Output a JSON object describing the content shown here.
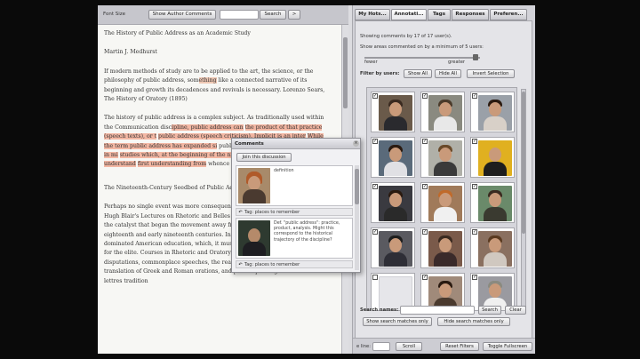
{
  "toolbar": {
    "font_size_label": "Font Size",
    "show_author_comments": "Show Author Comments",
    "search_button": "Search",
    "next_button": ">"
  },
  "document": {
    "title": "The History of Public Address as an Academic Study",
    "author": "Martin J. Medhurst",
    "p1": {
      "a": "If modern methods of study are to be applied to the art, the science, or the philosophy of public address, som",
      "hl": "ething",
      "b": " like a connected narrative of its beginning and growth its decadences and revivals is necessary.  Lorenzo Sears, The History of Oratory (1895)"
    },
    "p2": {
      "a": "The history of public address is a complex subject. As traditionally used within the Communication disc",
      "hl1": "ipline, public address can",
      "hl2": "the product of that practice (speech texts), or t",
      "hl3": "public address (speech criticism). Implicit is an inter",
      "hl4": "While the term public address has expanded si",
      "b": "public speeches, ",
      "hl5": "it is important to keep in mi",
      "hl6": "studies which, at the beginning of the nine-tee",
      "hl7": "and Oratory. We cannot understand",
      "hl8": "first understanding from",
      "c": " whence we came."
    },
    "heading2": "The Nineteenth-Century Seedbed of Public Ad",
    "p3": "Perhaps no single event was more consequent studies than the publication of Hugh Blair's Lectures on Rhetoric and Belles Lettres in 1783. Blair's book was the catalyst that began the movement away from Rhetoric and Oratory in the late eighteenth and early nineteenth centuries. In 1800, Rhetoric and Oratory still dominated American education, which, it must be remembered, was education for the elite. Courses in Rhetoric and Oratory emphasized declamations, disputations, commonplace speeches, the reading of dramatic dialogues, the translation of Greek and Roman orations, and public speaking. The new belles lettres tradition"
  },
  "panel": {
    "tabs": [
      "My Hots...",
      "Annotati...",
      "Tags",
      "Responses",
      "Preferen..."
    ],
    "showing": "Showing comments by 17 of 17 user(s).",
    "min_users": "Show areas commented on by a minimum of 5 users:",
    "fewer": "fewer",
    "greater": "greater",
    "filter_by_users": "Filter by users:",
    "show_all": "Show All",
    "hide_all": "Hide All",
    "invert_selection": "Invert Selection",
    "search_names": "Search names:",
    "search": "Search",
    "clear": "Clear",
    "show_matches_only": "Show search matches only",
    "hide_matches_only": "Hide search matches only",
    "bottom_line_label": "e line:",
    "scroll_button": "Scroll",
    "reset_filters": "Reset Filters",
    "toggle_fullscreen": "Toggle Fullscreen",
    "check_mark": "✓"
  },
  "popup": {
    "title": "Comments",
    "join": "Join this discussion",
    "close": "×",
    "c1_text": "definition",
    "c1_tag": "Tag: places to remember",
    "c2_text": "Def. \"public address\": practice, product, analysis. Might this correspond to the historical trajectory of the discipline?",
    "c2_tag": "Tag: places to remember",
    "reply_arrow": "↶"
  }
}
